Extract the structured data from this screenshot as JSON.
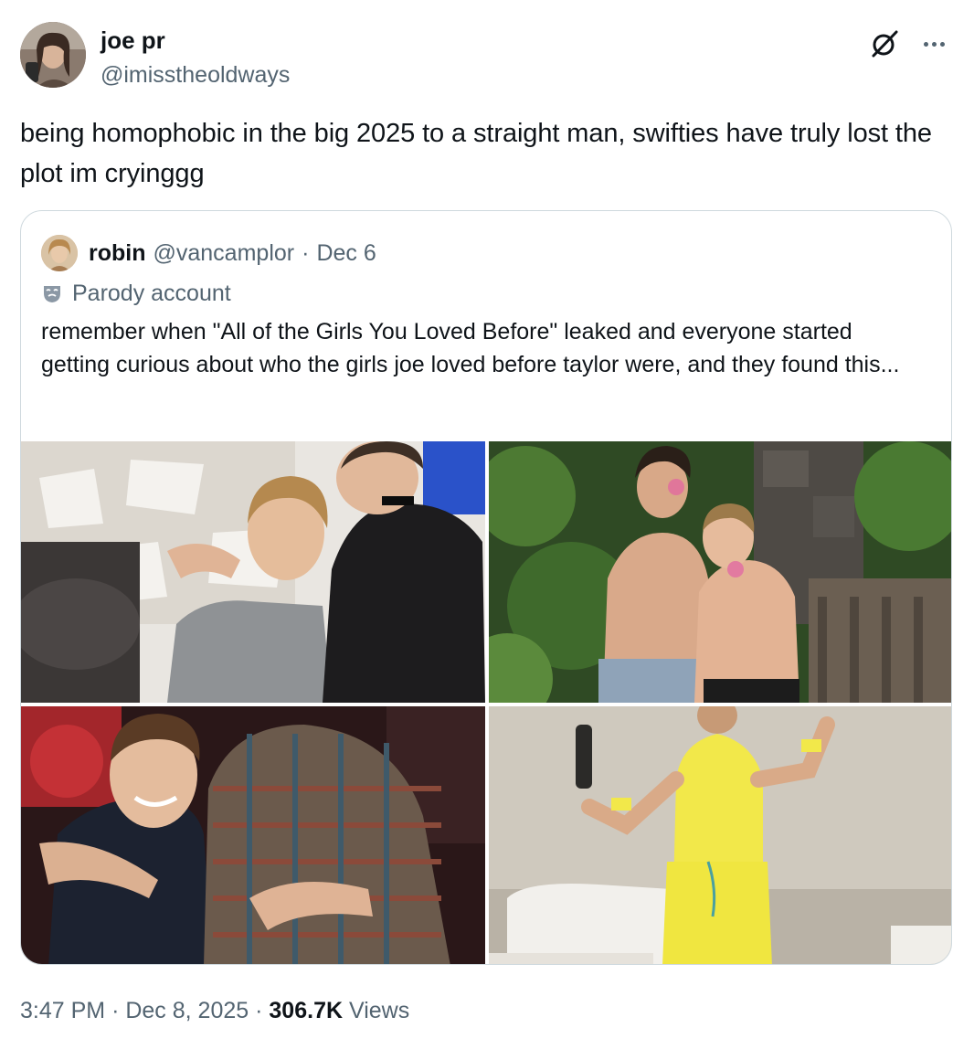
{
  "author": {
    "display_name": "joe pr",
    "handle": "@imisstheoldways"
  },
  "tweet": {
    "text": "being homophobic in the big 2025 to a straight man, swifties have truly lost the plot im cryinggg"
  },
  "quote": {
    "display_name": "robin",
    "handle": "@vancamplor",
    "separator": "·",
    "date": "Dec 6",
    "label": "Parody account",
    "text": "remember when \"All of the Girls You Loved Before\" leaked and everyone started getting curious about who the girls joe loved before taylor were, and they found this..."
  },
  "footer": {
    "time": "3:47 PM",
    "sep1": "·",
    "date": "Dec 8, 2025",
    "sep2": "·",
    "views_count": "306.7K",
    "views_label": "Views"
  },
  "icons": {
    "grok": "grok-icon",
    "more": "more-icon",
    "parody": "mask-icon"
  },
  "colors": {
    "text_primary": "#0f1419",
    "text_secondary": "#536471",
    "border": "#cfd9de"
  }
}
